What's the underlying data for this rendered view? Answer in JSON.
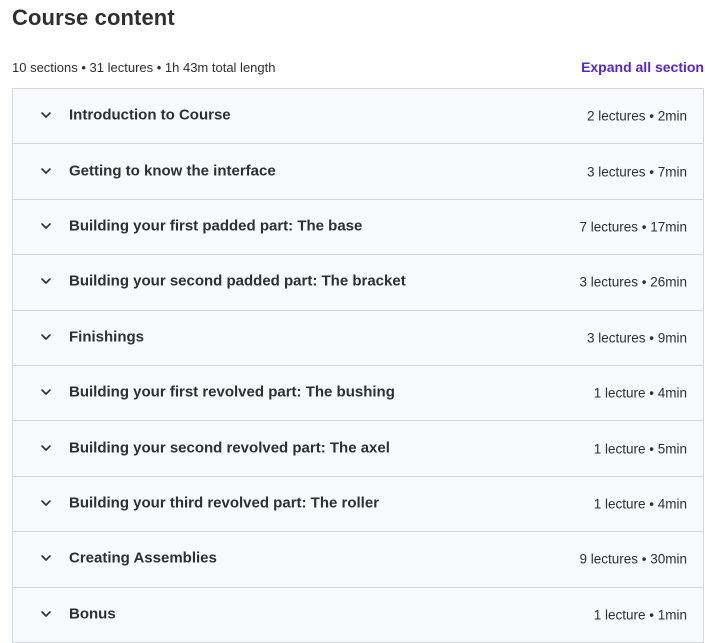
{
  "header": {
    "title": "Course content",
    "summary": "10 sections • 31 lectures • 1h 43m total length",
    "expand_label": "Expand all section"
  },
  "colors": {
    "accent": "#5624d0",
    "row_bg": "#f7f9fa",
    "border": "#d1d7dc",
    "text": "#2d2f31"
  },
  "sections": [
    {
      "title": "Introduction to Course",
      "meta": "2 lectures • 2min",
      "icon": "chevron-down-icon"
    },
    {
      "title": "Getting to know the interface",
      "meta": "3 lectures • 7min",
      "icon": "chevron-down-icon"
    },
    {
      "title": "Building your first padded part: The base",
      "meta": "7 lectures • 17min",
      "icon": "chevron-down-icon"
    },
    {
      "title": "Building your second padded part: The bracket",
      "meta": "3 lectures • 26min",
      "icon": "chevron-down-icon"
    },
    {
      "title": "Finishings",
      "meta": "3 lectures • 9min",
      "icon": "chevron-down-icon"
    },
    {
      "title": "Building your first revolved part: The bushing",
      "meta": "1 lecture • 4min",
      "icon": "chevron-down-icon"
    },
    {
      "title": "Building your second revolved part: The axel",
      "meta": "1 lecture • 5min",
      "icon": "chevron-down-icon"
    },
    {
      "title": "Building your third revolved part: The roller",
      "meta": "1 lecture • 4min",
      "icon": "chevron-down-icon"
    },
    {
      "title": "Creating Assemblies",
      "meta": "9 lectures • 30min",
      "icon": "chevron-down-icon"
    },
    {
      "title": "Bonus",
      "meta": "1 lecture • 1min",
      "icon": "chevron-down-icon"
    }
  ]
}
